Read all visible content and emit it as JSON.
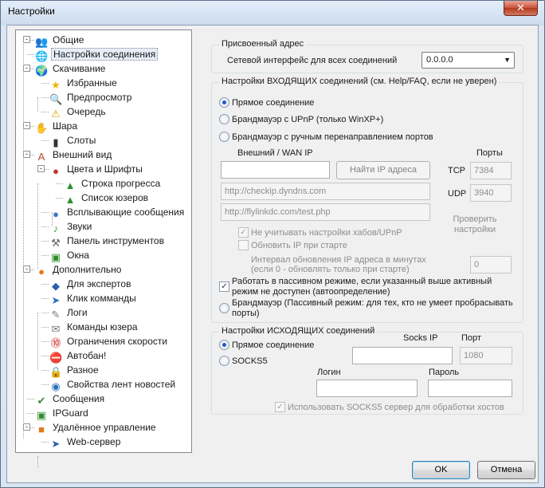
{
  "window": {
    "title": "Настройки",
    "close": "✕"
  },
  "tree": [
    {
      "label": "Общие",
      "icon": "users-icon"
    },
    {
      "label": "Настройки соединения",
      "icon": "network-globe-icon"
    },
    {
      "label": "Скачивание",
      "icon": "download-globe-icon"
    },
    {
      "label": "Избранные",
      "icon": "star-icon"
    },
    {
      "label": "Предпросмотр",
      "icon": "preview-icon"
    },
    {
      "label": "Очередь",
      "icon": "queue-icon"
    },
    {
      "label": "Шара",
      "icon": "share-hand-icon"
    },
    {
      "label": "Слоты",
      "icon": "slots-bars-icon"
    },
    {
      "label": "Внешний вид",
      "icon": "appearance-icon"
    },
    {
      "label": "Цвета и Шрифты",
      "icon": "palette-icon"
    },
    {
      "label": "Строка прогресса",
      "icon": "progress-tree-icon"
    },
    {
      "label": "Список юзеров",
      "icon": "userlist-tree-icon"
    },
    {
      "label": "Всплывающие сообщения",
      "icon": "popup-icon"
    },
    {
      "label": "Звуки",
      "icon": "sound-note-icon"
    },
    {
      "label": "Панель инструментов",
      "icon": "tools-icon"
    },
    {
      "label": "Окна",
      "icon": "windows-icon"
    },
    {
      "label": "Дополнительно",
      "icon": "advanced-icon"
    },
    {
      "label": "Для экспертов",
      "icon": "expert-icon"
    },
    {
      "label": "Клик комманды",
      "icon": "command-icon"
    },
    {
      "label": "Логи",
      "icon": "logs-icon"
    },
    {
      "label": "Команды юзера",
      "icon": "user-commands-icon"
    },
    {
      "label": "Ограничения скорости",
      "icon": "speed-limit-icon"
    },
    {
      "label": "Автобан!",
      "icon": "autoban-icon"
    },
    {
      "label": "Разное",
      "icon": "lock-icon"
    },
    {
      "label": "Свойства лент новостей",
      "icon": "rss-globe-icon"
    },
    {
      "label": "Сообщения",
      "icon": "messages-check-icon"
    },
    {
      "label": "IPGuard",
      "icon": "ipguard-icon"
    },
    {
      "label": "Удалённое управление",
      "icon": "remote-box-icon"
    },
    {
      "label": "Web-сервер",
      "icon": "web-server-icon"
    }
  ],
  "assigned": {
    "legend": "Присвоенный адрес",
    "iface_label": "Сетевой интерфейс для всех соединений",
    "iface_value": "0.0.0.0"
  },
  "incoming": {
    "legend": "Настройки ВХОДЯЩИХ соединений (см. Help/FAQ, если не уверен)",
    "opt_direct": "Прямое соединение",
    "opt_upnp": "Брандмауэр с UPnP (только WinXP+)",
    "opt_manual": "Брандмауэр с ручным перенаправлением портов",
    "wan_label": "Внешний / WAN IP",
    "ports_label": "Порты",
    "wan_value": "",
    "find_ip": "Найти IP адреса",
    "tcp_label": "TCP",
    "tcp_value": "7384",
    "udp_label": "UDP",
    "udp_value": "3940",
    "url1": "http://checkip.dyndns.com",
    "url2": "http://flylinkdc.com/test.php",
    "check_settings": "Проверить настройки",
    "ignore_hubs": "Не учитывать настройки хабов/UPnP",
    "update_ip": "Обновить IP при старте",
    "interval_label": "Интервал обновления IP адреса в минутах (если 0 - обновлять только при старте)",
    "interval_value": "0",
    "passive_auto": "Работать в пассивном режиме, если указанный выше активный режим не доступен (автоопределение)",
    "passive_fw": "Брандмауэр (Пассивный режим: для тех, кто не умеет пробрасывать порты)"
  },
  "outgoing": {
    "legend": "Настройки ИСХОДЯЩИХ соединений",
    "opt_direct": "Прямое соединение",
    "opt_socks": "SOCKS5",
    "socks_ip_label": "Socks IP",
    "port_label": "Порт",
    "socks_ip": "",
    "port_value": "1080",
    "login_label": "Логин",
    "password_label": "Пароль",
    "login_value": "",
    "password_value": "",
    "use_socks_hosts": "Использовать SOCKS5 сервер для обработки хостов"
  },
  "buttons": {
    "ok": "OK",
    "cancel": "Отмена"
  },
  "colors": {
    "selection": "#e6eef9",
    "accent": "#1b5ac9",
    "close": "#c9533b"
  }
}
